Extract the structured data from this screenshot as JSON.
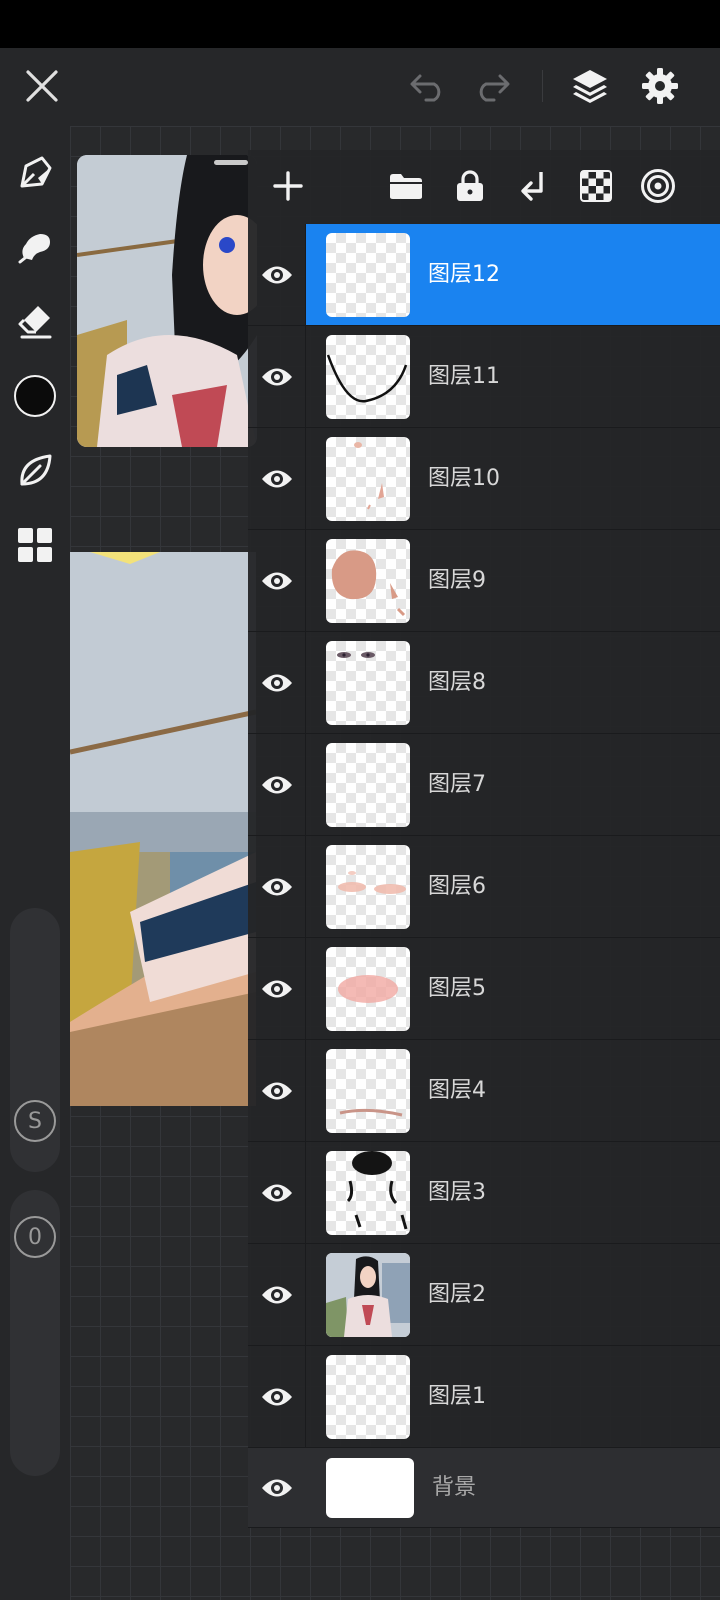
{
  "window": {
    "title": ""
  },
  "topbar": {
    "close_icon": "close-icon",
    "undo_icon": "undo-icon",
    "redo_icon": "redo-icon",
    "layers_icon": "layers-icon",
    "settings_icon": "gear-icon"
  },
  "left_toolbar": {
    "tools": [
      "pen-icon",
      "smudge-icon",
      "eraser-icon",
      "color-swatch",
      "leaf-icon",
      "grid-icon"
    ],
    "current_color": "#0b0b0b",
    "size_slider_label": "S",
    "opacity_slider_label": "0"
  },
  "layers_panel": {
    "toolbar_icons": [
      "plus-icon",
      "folder-icon",
      "lock-icon",
      "merge-down-icon",
      "checkerboard-icon",
      "target-icon"
    ],
    "layers": [
      {
        "name": "图层12",
        "selected": true,
        "visible": true
      },
      {
        "name": "图层11",
        "selected": false,
        "visible": true
      },
      {
        "name": "图层10",
        "selected": false,
        "visible": true
      },
      {
        "name": "图层9",
        "selected": false,
        "visible": true
      },
      {
        "name": "图层8",
        "selected": false,
        "visible": true
      },
      {
        "name": "图层7",
        "selected": false,
        "visible": true
      },
      {
        "name": "图层6",
        "selected": false,
        "visible": true
      },
      {
        "name": "图层5",
        "selected": false,
        "visible": true
      },
      {
        "name": "图层4",
        "selected": false,
        "visible": true
      },
      {
        "name": "图层3",
        "selected": false,
        "visible": true
      },
      {
        "name": "图层2",
        "selected": false,
        "visible": true
      },
      {
        "name": "图层1",
        "selected": false,
        "visible": true
      }
    ],
    "background_layer": {
      "name": "背景",
      "visible": true
    }
  },
  "colors": {
    "accent": "#1a83f0",
    "panel": "#242528",
    "toolbar": "#262729"
  }
}
